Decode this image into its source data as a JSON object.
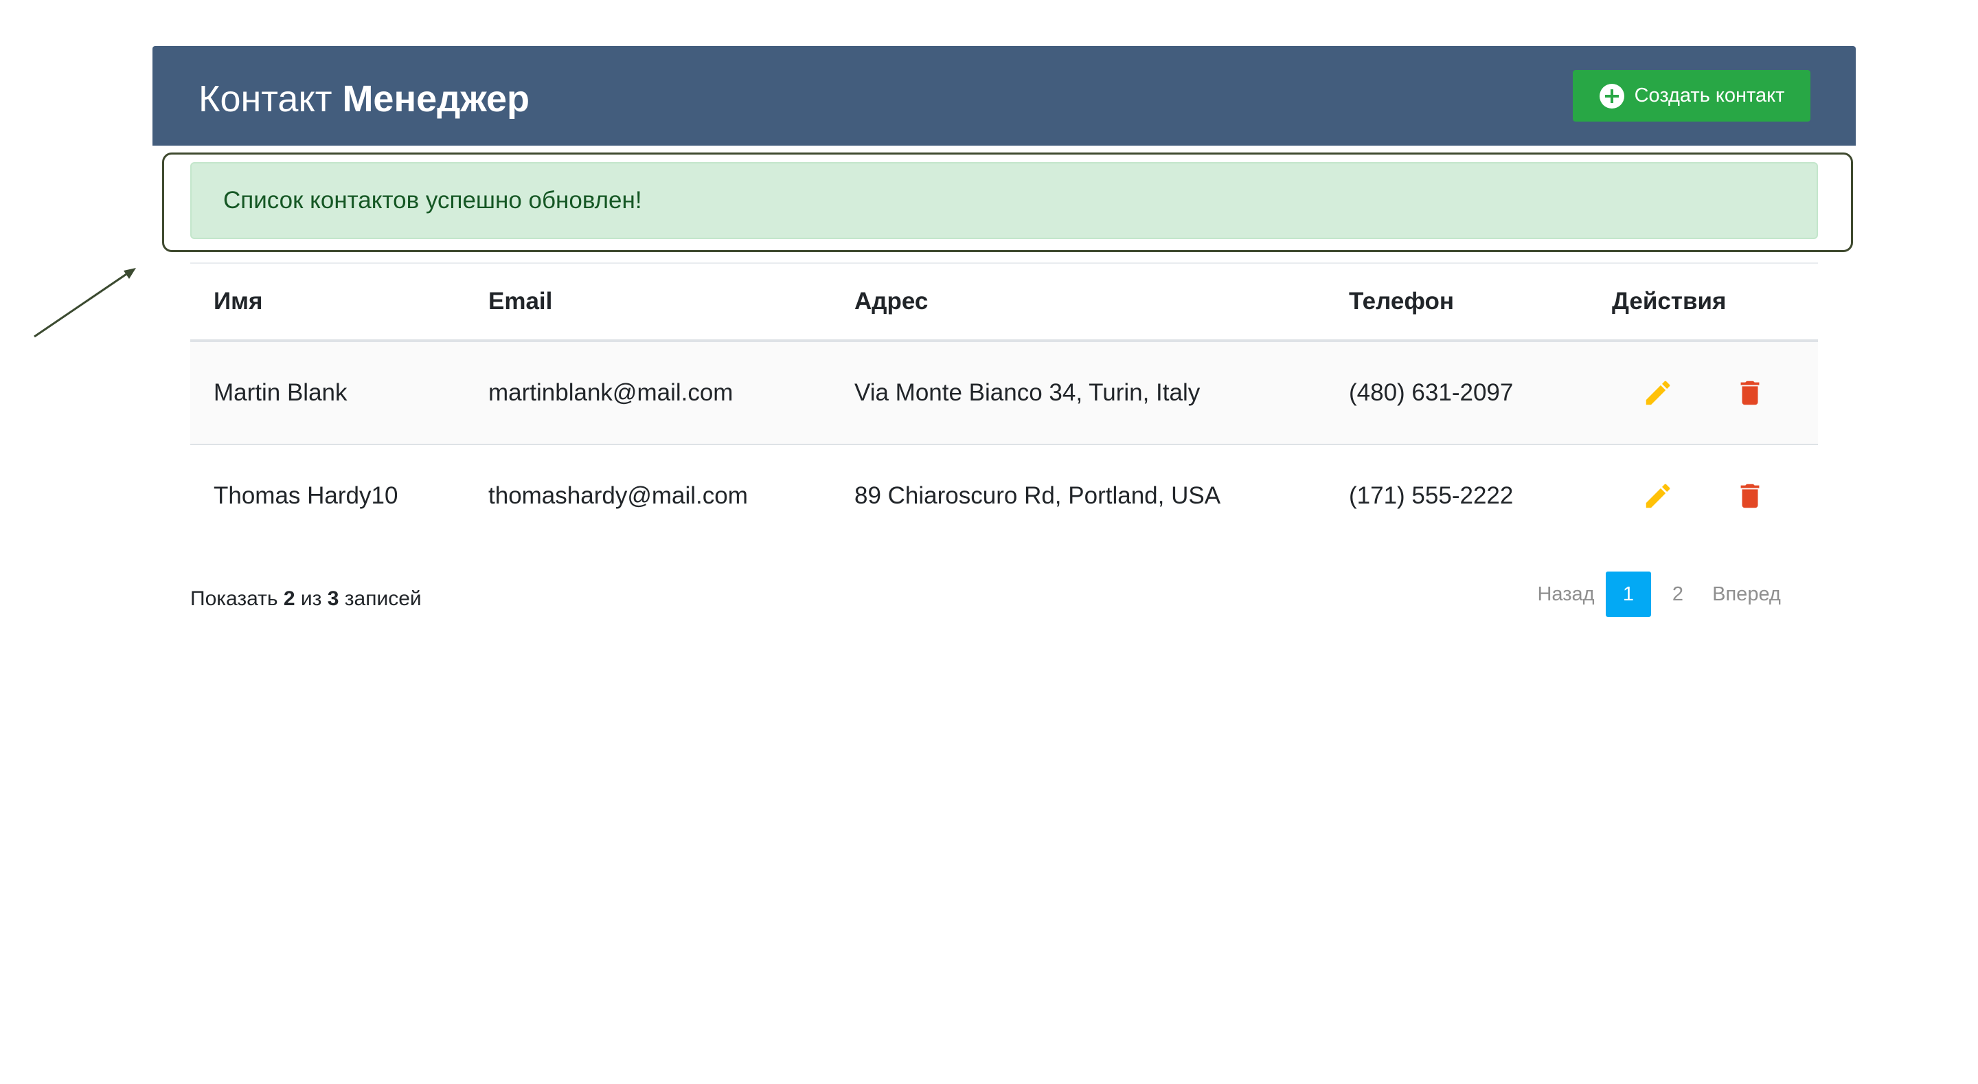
{
  "header": {
    "title_light": "Контакт",
    "title_bold": "Менеджер",
    "create_button_label": "Создать контакт"
  },
  "alert": {
    "message": "Список контактов успешно обновлен!"
  },
  "table": {
    "columns": [
      "Имя",
      "Email",
      "Адрес",
      "Телефон",
      "Действия"
    ],
    "rows": [
      {
        "name": "Martin Blank",
        "email": "martinblank@mail.com",
        "address": "Via Monte Bianco 34, Turin, Italy",
        "phone": "(480) 631-2097"
      },
      {
        "name": "Thomas Hardy10",
        "email": "thomashardy@mail.com",
        "address": "89 Chiaroscuro Rd, Portland, USA",
        "phone": "(171) 555-2222"
      }
    ]
  },
  "footer": {
    "show_label": "Показать",
    "shown_count": "2",
    "of_label": "из",
    "total_count": "3",
    "records_label": "записей"
  },
  "pagination": {
    "prev_label": "Назад",
    "pages": [
      "1",
      "2"
    ],
    "active_page": "1",
    "next_label": "Вперед"
  },
  "colors": {
    "header_bg": "#435d7d",
    "create_button": "#28a745",
    "alert_bg": "#d4edda",
    "alert_text": "#155724",
    "edit_icon": "#ffc107",
    "delete_icon": "#e34724",
    "active_page": "#03a9f4"
  },
  "icons": {
    "create": "plus-circle-icon",
    "edit": "pencil-icon",
    "delete": "trash-icon"
  }
}
